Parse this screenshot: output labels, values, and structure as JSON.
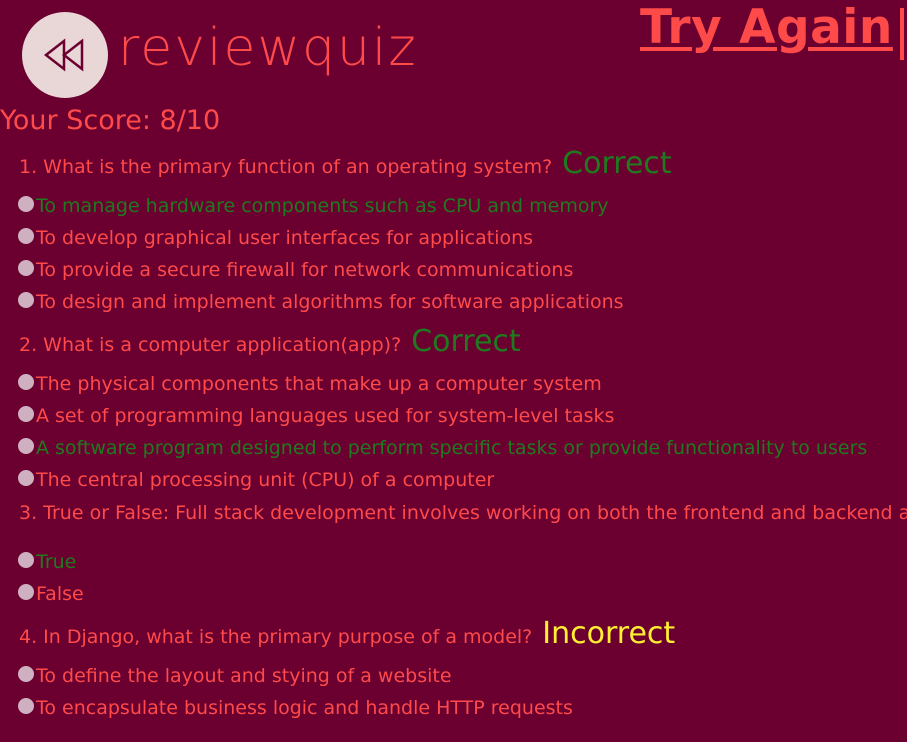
{
  "header": {
    "brand": "reviewquiz",
    "logo_icon": "rewind-icon",
    "try_again_label": "Try Again"
  },
  "score_label": "Your Score: 8/10",
  "colors": {
    "background": "#6b0030",
    "text": "#ff4a4a",
    "correct": "#1f7a1f",
    "incorrect": "#ffee33",
    "logo_bg": "#e9d6d6"
  },
  "questions": [
    {
      "text": "1. What is the primary function of an operating system?",
      "verdict": "Correct",
      "options": [
        "To manage hardware components such as CPU and memory",
        "To develop graphical user interfaces for applications",
        "To provide a secure firewall for network communications",
        "To design and implement algorithms for software applications"
      ]
    },
    {
      "text": "2. What is a computer application(app)?",
      "verdict": "Correct",
      "options": [
        "The physical components that make up a computer system",
        "A set of programming languages used for system-level tasks",
        "A software program designed to perform specific tasks or provide functionality to users",
        "The central processing unit (CPU) of a computer"
      ]
    },
    {
      "text": "3. True or False: Full stack development involves working on both the frontend and backend a",
      "verdict": "",
      "options": [
        "True",
        "False"
      ]
    },
    {
      "text": "4. In Django, what is the primary purpose of a model?",
      "verdict": "Incorrect",
      "options": [
        "To define the layout and stying of a website",
        "To encapsulate business logic and handle HTTP requests"
      ]
    }
  ]
}
